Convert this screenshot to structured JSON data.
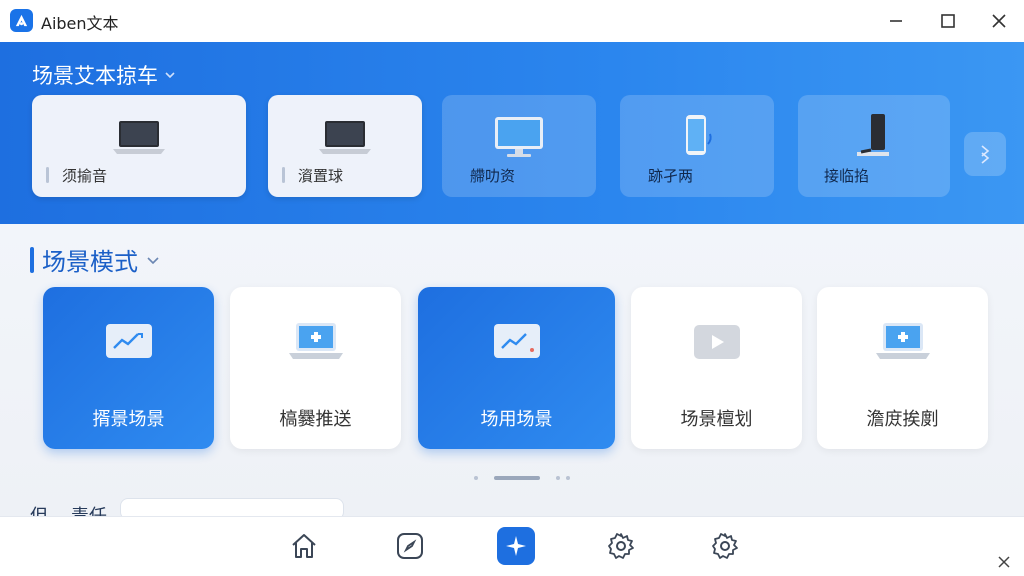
{
  "window": {
    "title": "Aiben文本"
  },
  "hero": {
    "title": "场景艾本掠车",
    "devices": [
      {
        "label": "须揄音",
        "icon": "laptop-icon",
        "style": "light"
      },
      {
        "label": "澬置球",
        "icon": "laptop-icon",
        "style": "light"
      },
      {
        "label": "艜叻资",
        "icon": "monitor-icon",
        "style": "glass"
      },
      {
        "label": "跡孑两",
        "icon": "phone-icon",
        "style": "glass"
      },
      {
        "label": "接临掐",
        "icon": "tablet-stand-icon",
        "style": "glass"
      }
    ]
  },
  "scenes": {
    "title": "场景模式",
    "cards": [
      {
        "label": "揟景场景",
        "icon": "chart-icon",
        "active": true
      },
      {
        "label": "槁爨推送",
        "icon": "laptop-icon",
        "active": false
      },
      {
        "label": "场用场景",
        "icon": "chart-icon",
        "active": true
      },
      {
        "label": "场景檀划",
        "icon": "play-icon",
        "active": false
      },
      {
        "label": "澹庻挨剫",
        "icon": "laptop-icon",
        "active": false
      }
    ],
    "peek_text": "但 ..  毒任"
  },
  "bottom_nav": {
    "items": [
      "home-icon",
      "compass-icon",
      "sparkle-icon",
      "gear-icon",
      "gear-icon"
    ],
    "active_index": 2
  },
  "colors": {
    "accent": "#1e6fe0",
    "hero_gradient_end": "#3b97f3",
    "background": "#f2f5fa"
  }
}
